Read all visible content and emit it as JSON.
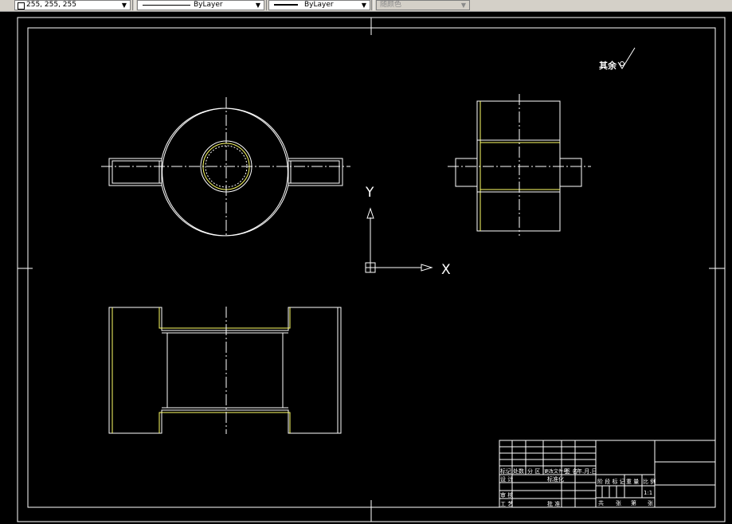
{
  "toolbar": {
    "color_value": "255, 255, 255",
    "linetype_value": "ByLayer",
    "lineweight_value": "ByLayer",
    "plotstyle_value": "随颜色"
  },
  "drawing": {
    "surface_note": "其余",
    "ucs": {
      "x_label": "X",
      "y_label": "Y"
    },
    "title_block": {
      "left_header": [
        "标记",
        "处数",
        "分 区",
        "更改文件号",
        "签 名",
        "年.月.日"
      ],
      "design_row": [
        "设 计",
        "",
        "标准化"
      ],
      "review_row": [
        "审 核"
      ],
      "process_row": [
        "工 艺",
        "",
        "批 准"
      ],
      "stage_headers": [
        "阶 段 标 记",
        "重 量",
        "比 例"
      ],
      "scale": "1:1",
      "sheet_row": [
        "共",
        "张",
        "第",
        "张"
      ]
    },
    "colors": {
      "white": "#ffffff",
      "yellow": "#ffff66",
      "background": "#000000"
    }
  }
}
